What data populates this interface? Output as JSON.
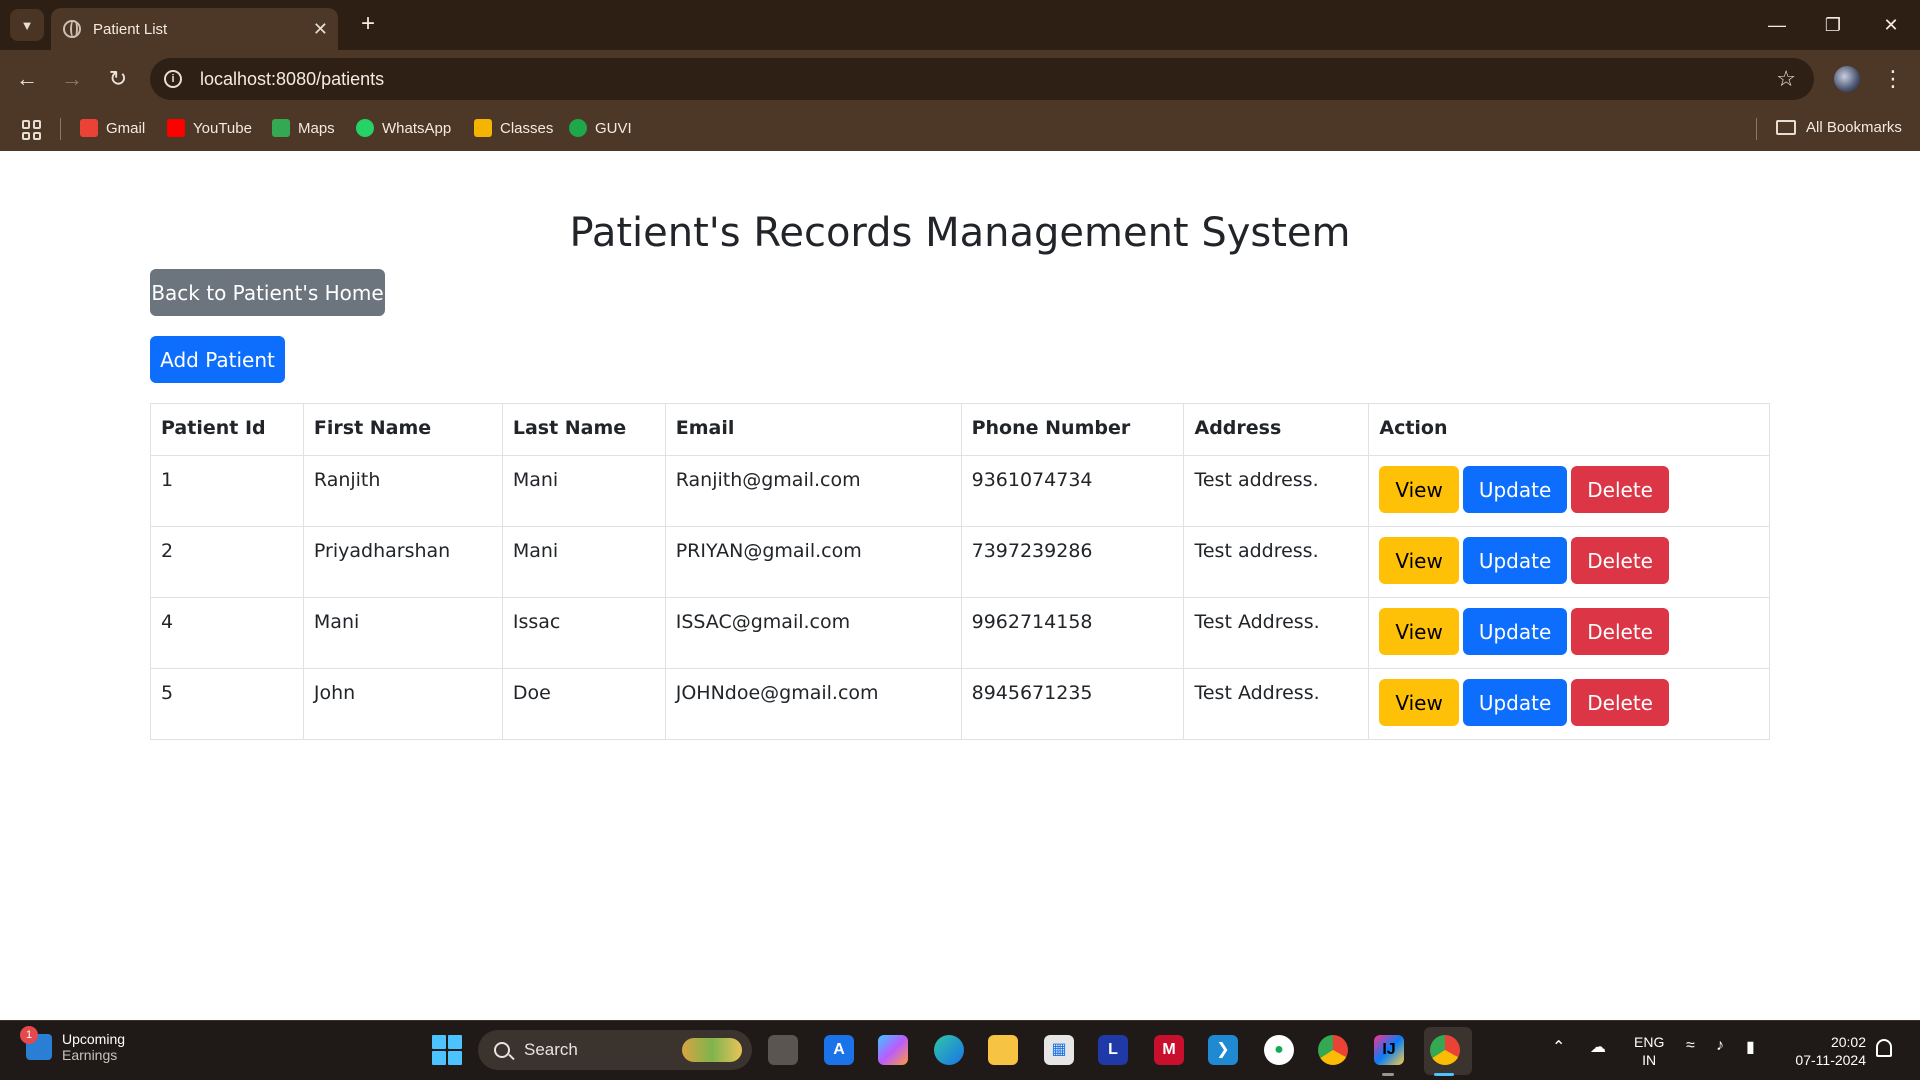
{
  "browser": {
    "tab_title": "Patient List",
    "url": "localhost:8080/patients",
    "bookmarks": [
      {
        "label": "Gmail",
        "color": "#ea4335"
      },
      {
        "label": "YouTube",
        "color": "#ff0000"
      },
      {
        "label": "Maps",
        "color": "#34a853"
      },
      {
        "label": "WhatsApp",
        "color": "#25d366"
      },
      {
        "label": "Classes",
        "color": "#f4b400"
      },
      {
        "label": "GUVI",
        "color": "#1ea84a"
      }
    ],
    "all_bookmarks": "All Bookmarks"
  },
  "page": {
    "title": "Patient's Records Management System",
    "back_button": "Back to Patient's Home",
    "add_button": "Add Patient"
  },
  "table": {
    "headers": [
      "Patient Id",
      "First Name",
      "Last Name",
      "Email",
      "Phone Number",
      "Address",
      "Action"
    ],
    "rows": [
      {
        "id": "1",
        "first": "Ranjith",
        "last": "Mani",
        "email": "Ranjith@gmail.com",
        "phone": "9361074734",
        "address": "Test address."
      },
      {
        "id": "2",
        "first": "Priyadharshan",
        "last": "Mani",
        "email": "PRIYAN@gmail.com",
        "phone": "7397239286",
        "address": "Test address."
      },
      {
        "id": "4",
        "first": "Mani",
        "last": "Issac",
        "email": "ISSAC@gmail.com",
        "phone": "9962714158",
        "address": "Test Address."
      },
      {
        "id": "5",
        "first": "John",
        "last": "Doe",
        "email": "JOHNdoe@gmail.com",
        "phone": "8945671235",
        "address": "Test Address."
      }
    ],
    "actions": {
      "view": "View",
      "update": "Update",
      "delete": "Delete"
    }
  },
  "taskbar": {
    "weather_title": "Upcoming",
    "weather_sub": "Earnings",
    "weather_badge": "1",
    "search_label": "Search",
    "lang_line1": "ENG",
    "lang_line2": "IN",
    "time": "20:02",
    "date": "07-11-2024"
  },
  "colors": {
    "chrome_dark": "#2e1f14",
    "chrome": "#4d3726",
    "primary": "#0d6efd",
    "secondary": "#6c757d",
    "warning": "#ffc107",
    "danger": "#dc3545"
  }
}
